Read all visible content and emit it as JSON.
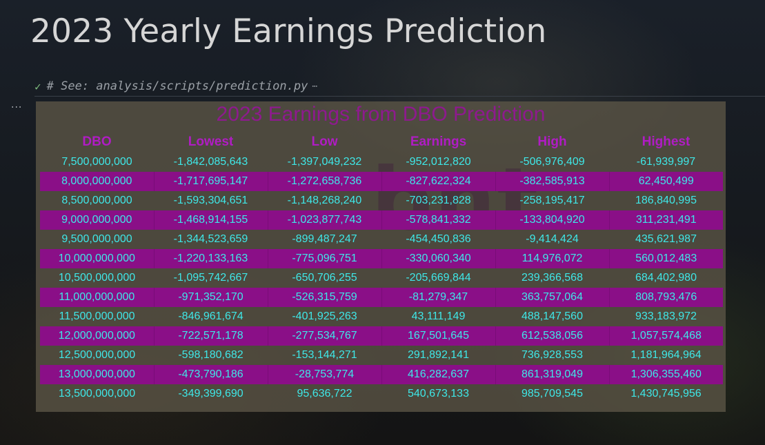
{
  "page": {
    "title": "2023 Yearly Earnings Prediction"
  },
  "cell": {
    "status_icon": "check-icon",
    "code_comment": "# See: analysis/scripts/prediction.py",
    "collapsed_indicator": "⋯",
    "output_more": "..."
  },
  "figure": {
    "title": "2023 Earnings from DBO Prediction",
    "watermark": "bnt"
  },
  "table": {
    "headers": [
      "DBO",
      "Lowest",
      "Low",
      "Earnings",
      "High",
      "Highest"
    ],
    "rows": [
      [
        "7,500,000,000",
        "-1,842,085,643",
        "-1,397,049,232",
        "-952,012,820",
        "-506,976,409",
        "-61,939,997"
      ],
      [
        "8,000,000,000",
        "-1,717,695,147",
        "-1,272,658,736",
        "-827,622,324",
        "-382,585,913",
        "62,450,499"
      ],
      [
        "8,500,000,000",
        "-1,593,304,651",
        "-1,148,268,240",
        "-703,231,828",
        "-258,195,417",
        "186,840,995"
      ],
      [
        "9,000,000,000",
        "-1,468,914,155",
        "-1,023,877,743",
        "-578,841,332",
        "-133,804,920",
        "311,231,491"
      ],
      [
        "9,500,000,000",
        "-1,344,523,659",
        "-899,487,247",
        "-454,450,836",
        "-9,414,424",
        "435,621,987"
      ],
      [
        "10,000,000,000",
        "-1,220,133,163",
        "-775,096,751",
        "-330,060,340",
        "114,976,072",
        "560,012,483"
      ],
      [
        "10,500,000,000",
        "-1,095,742,667",
        "-650,706,255",
        "-205,669,844",
        "239,366,568",
        "684,402,980"
      ],
      [
        "11,000,000,000",
        "-971,352,170",
        "-526,315,759",
        "-81,279,347",
        "363,757,064",
        "808,793,476"
      ],
      [
        "11,500,000,000",
        "-846,961,674",
        "-401,925,263",
        "43,111,149",
        "488,147,560",
        "933,183,972"
      ],
      [
        "12,000,000,000",
        "-722,571,178",
        "-277,534,767",
        "167,501,645",
        "612,538,056",
        "1,057,574,468"
      ],
      [
        "12,500,000,000",
        "-598,180,682",
        "-153,144,271",
        "291,892,141",
        "736,928,553",
        "1,181,964,964"
      ],
      [
        "13,000,000,000",
        "-473,790,186",
        "-28,753,774",
        "416,282,637",
        "861,319,049",
        "1,306,355,460"
      ],
      [
        "13,500,000,000",
        "-349,399,690",
        "95,636,722",
        "540,673,133",
        "985,709,545",
        "1,430,745,956"
      ]
    ]
  },
  "colors": {
    "figure_title": "#8e1a8e",
    "header_text": "#b01cc4",
    "cell_text": "#3ee8e8",
    "row_stripe": "#8a0f87",
    "page_title": "#d6d6d6"
  }
}
